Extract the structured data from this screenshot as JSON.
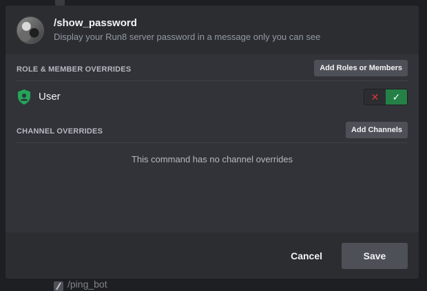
{
  "command": {
    "name": "/show_password",
    "description": "Display your Run8 server password in a message only you can see"
  },
  "role_section": {
    "label": "ROLE & MEMBER OVERRIDES",
    "button": "Add Roles or Members",
    "overrides": [
      {
        "name": "User",
        "state": "allowed"
      }
    ]
  },
  "channel_section": {
    "label": "CHANNEL OVERRIDES",
    "button": "Add Channels",
    "empty_text": "This command has no channel overrides"
  },
  "toggle": {
    "deny_symbol": "✕",
    "allow_symbol": "✓"
  },
  "footer": {
    "cancel_label": "Cancel",
    "save_label": "Save"
  },
  "background": {
    "list_item": "/ping_bot"
  },
  "colors": {
    "accent_allow": "#248046",
    "deny": "#da373c",
    "shield": "#23a55a"
  }
}
